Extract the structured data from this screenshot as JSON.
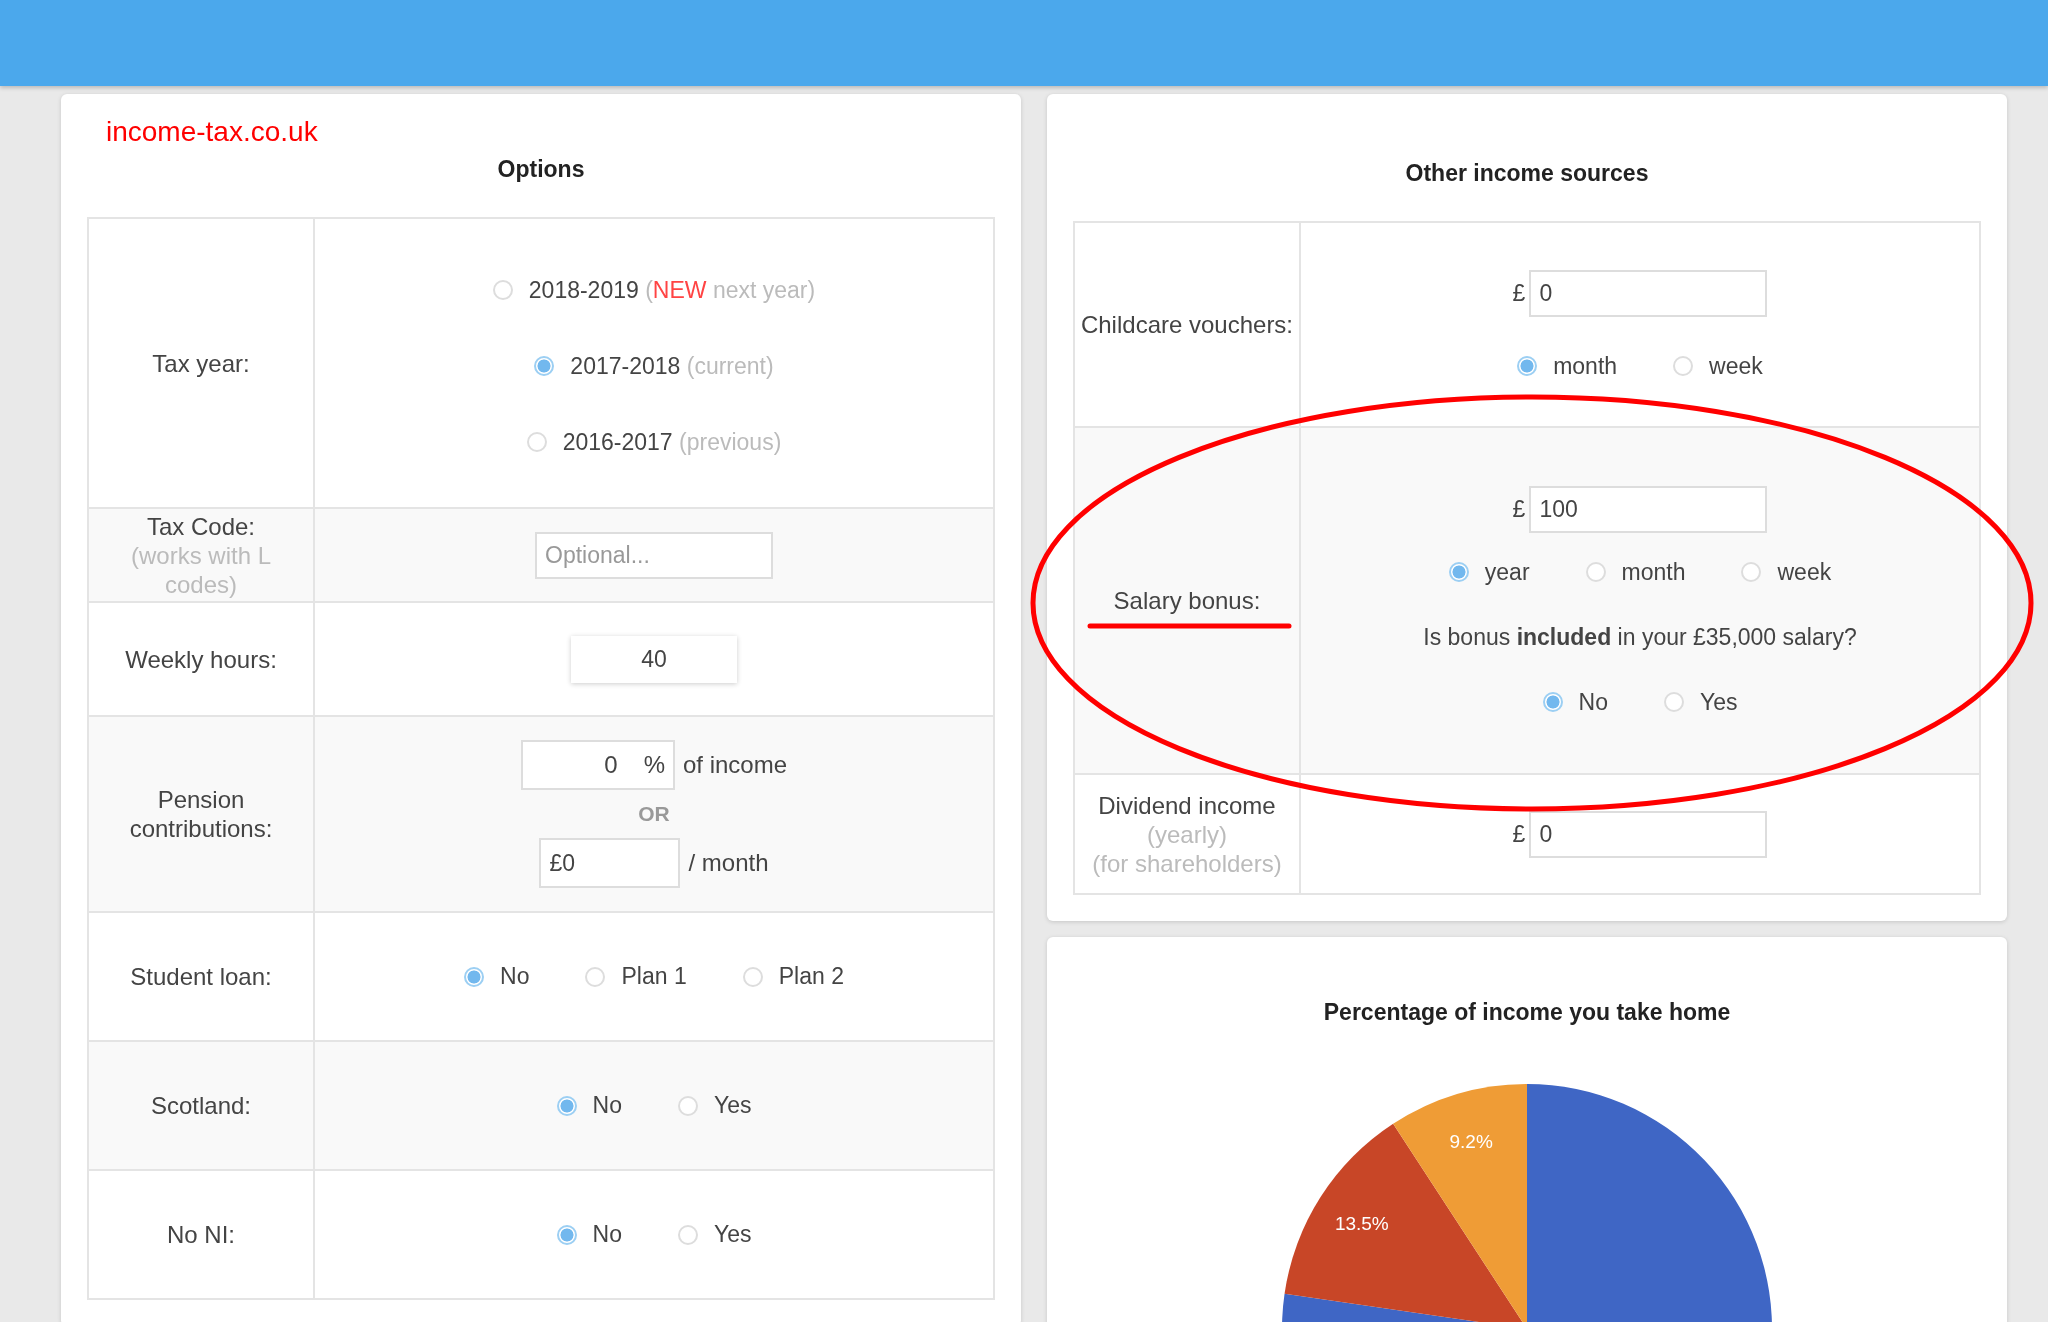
{
  "options_panel": {
    "site_title": "income-tax.co.uk",
    "title": "Options",
    "rows": [
      {
        "label": "Tax year:",
        "fields": [
          {
            "kind": "radio_stack",
            "options": [
              {
                "label": "2018-2019",
                "note": [
                  {
                    "kind": "muted",
                    "text": "("
                  },
                  {
                    "kind": "new",
                    "text": "NEW"
                  },
                  {
                    "kind": "muted",
                    "text": " next year)"
                  }
                ],
                "selected": false
              },
              {
                "label": "2017-2018",
                "note": [
                  {
                    "kind": "muted",
                    "text": "(current)"
                  }
                ],
                "selected": true
              },
              {
                "label": "2016-2017",
                "note": [
                  {
                    "kind": "muted",
                    "text": "(previous)"
                  }
                ],
                "selected": false
              }
            ]
          }
        ]
      },
      {
        "label": "Tax Code:",
        "sublabels": [
          "(works with L codes)"
        ],
        "fields": [
          {
            "kind": "input",
            "placeholder": "Optional..."
          }
        ]
      },
      {
        "label": "Weekly hours:",
        "fields": [
          {
            "kind": "number",
            "value": "40"
          }
        ]
      },
      {
        "label": "Pension contributions:",
        "fields": [
          {
            "kind": "percent",
            "value": "0",
            "unit": "%",
            "suffix": "of income"
          },
          {
            "kind": "separator",
            "text": "OR"
          },
          {
            "kind": "amount",
            "value": "£0",
            "suffix": "/ month"
          }
        ]
      },
      {
        "label": "Student loan:",
        "fields": [
          {
            "kind": "radio_row",
            "options": [
              {
                "label": "No",
                "selected": true
              },
              {
                "label": "Plan 1",
                "selected": false
              },
              {
                "label": "Plan 2",
                "selected": false
              }
            ]
          }
        ]
      },
      {
        "label": "Scotland:",
        "fields": [
          {
            "kind": "radio_row",
            "options": [
              {
                "label": "No",
                "selected": true
              },
              {
                "label": "Yes",
                "selected": false
              }
            ]
          }
        ]
      },
      {
        "label": "No NI:",
        "fields": [
          {
            "kind": "radio_row",
            "options": [
              {
                "label": "No",
                "selected": true
              },
              {
                "label": "Yes",
                "selected": false
              }
            ]
          }
        ]
      }
    ]
  },
  "other_income_panel": {
    "title": "Other income sources",
    "rows": [
      {
        "label": "Childcare vouchers:",
        "fields": [
          {
            "kind": "money",
            "currency": "£",
            "value": "0"
          },
          {
            "kind": "radio_row",
            "options": [
              {
                "label": "month",
                "selected": true
              },
              {
                "label": "week",
                "selected": false
              }
            ]
          }
        ]
      },
      {
        "label": "Salary bonus:",
        "fields": [
          {
            "kind": "money",
            "currency": "£",
            "value": "100"
          },
          {
            "kind": "radio_row",
            "options": [
              {
                "label": "year",
                "selected": true
              },
              {
                "label": "month",
                "selected": false
              },
              {
                "label": "week",
                "selected": false
              }
            ]
          },
          {
            "kind": "question",
            "text": "Is bonus **included** in your £35,000 salary?"
          },
          {
            "kind": "radio_row",
            "options": [
              {
                "label": "No",
                "selected": true
              },
              {
                "label": "Yes",
                "selected": false
              }
            ]
          }
        ]
      },
      {
        "label": "Dividend income",
        "sublabels": [
          "(yearly)",
          "(for shareholders)"
        ],
        "fields": [
          {
            "kind": "money",
            "currency": "£",
            "value": "0"
          }
        ]
      }
    ]
  },
  "chart_panel": {
    "chart_data": {
      "type": "pie",
      "title": "Percentage of income you take home",
      "values": [
        77.3,
        13.5,
        9.2
      ],
      "colors": [
        "#3f66c5",
        "#c84627",
        "#ef9c36"
      ],
      "value_labels": [
        null,
        "13.5%",
        "9.2%"
      ]
    }
  }
}
